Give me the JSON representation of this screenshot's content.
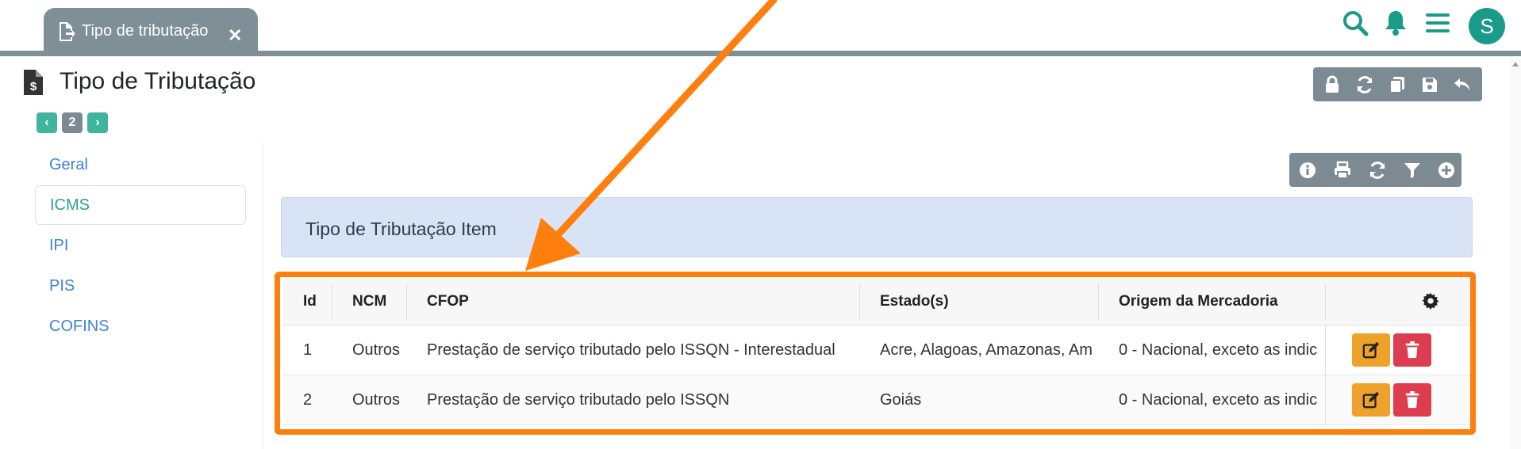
{
  "tab": {
    "label": "Tipo de tributação",
    "icon": "file-export-icon"
  },
  "header_icons": [
    "search-icon",
    "bell-icon",
    "menu-icon"
  ],
  "user": {
    "avatar_letter": "S"
  },
  "page": {
    "title": "Tipo de Tributação",
    "icon": "file-invoice-dollar-icon"
  },
  "pager": {
    "prev": "‹",
    "number": "2",
    "next": "›"
  },
  "toolbar_top": [
    "lock-icon",
    "sync-icon",
    "copy-icon",
    "save-icon",
    "undo-icon"
  ],
  "toolbar_grid": [
    "info-icon",
    "print-icon",
    "sync-icon",
    "filter-icon",
    "plus-circle-icon"
  ],
  "sidebar": {
    "items": [
      {
        "label": "Geral",
        "active": false
      },
      {
        "label": "ICMS",
        "active": true
      },
      {
        "label": "IPI",
        "active": false
      },
      {
        "label": "PIS",
        "active": false
      },
      {
        "label": "COFINS",
        "active": false
      }
    ]
  },
  "panel": {
    "title": "Tipo de Tributação Item"
  },
  "table": {
    "columns": [
      "Id",
      "NCM",
      "CFOP",
      "Estado(s)",
      "Origem da Mercadoria"
    ],
    "settings_icon": "gear-icon",
    "rows": [
      {
        "id": "1",
        "ncm": "Outros",
        "cfop": "Prestação de serviço tributado pelo ISSQN - Interestadual",
        "estados": "Acre, Alagoas, Amazonas, Am",
        "origem": "0 - Nacional, exceto as indic"
      },
      {
        "id": "2",
        "ncm": "Outros",
        "cfop": "Prestação de serviço tributado pelo ISSQN",
        "estados": "Goiás",
        "origem": "0 - Nacional, exceto as indic"
      }
    ]
  },
  "colors": {
    "annotation": "#ff7f0e",
    "teal": "#1a9b8a",
    "edit": "#eea22b",
    "delete": "#dc3d4f"
  }
}
